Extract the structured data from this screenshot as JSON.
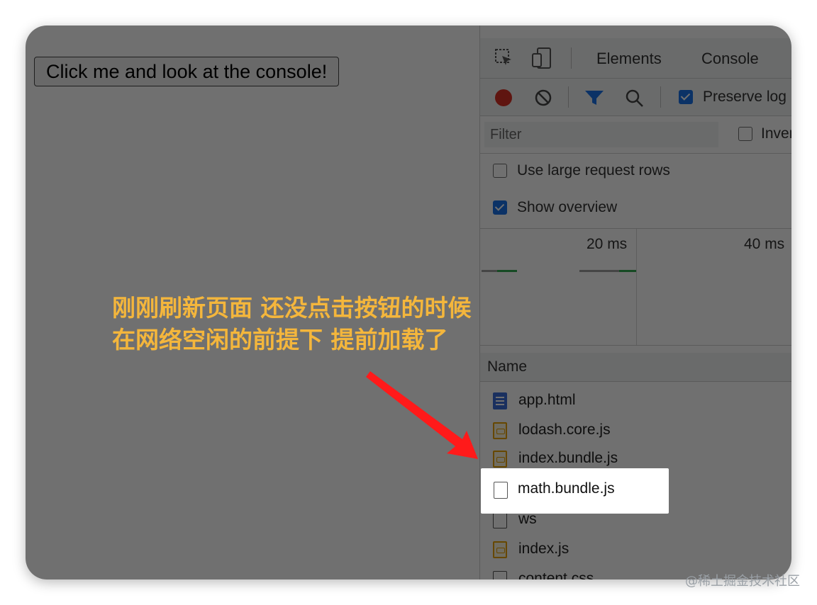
{
  "page": {
    "button_label": "Click me and look at the console!"
  },
  "devtools": {
    "tabs": [
      "Elements",
      "Console"
    ],
    "toolbar": {
      "preserve_log_label": "Preserve log",
      "preserve_log_checked": true
    },
    "filter": {
      "placeholder": "Filter",
      "invert_label": "Invert",
      "invert_checked": false
    },
    "options": {
      "large_rows_label": "Use large request rows",
      "large_rows_checked": false,
      "show_overview_label": "Show overview",
      "show_overview_checked": true
    },
    "overview": {
      "ticks": [
        "20 ms",
        "40 ms"
      ]
    },
    "table": {
      "header": "Name",
      "rows": [
        {
          "name": "app.html",
          "icon": "document-icon"
        },
        {
          "name": "lodash.core.js",
          "icon": "script-icon"
        },
        {
          "name": "index.bundle.js",
          "icon": "script-icon"
        },
        {
          "name": "math.bundle.js",
          "icon": "blank-file-icon",
          "highlighted": true
        },
        {
          "name": "ws",
          "icon": "blank-file-icon"
        },
        {
          "name": "index.js",
          "icon": "script-icon"
        },
        {
          "name": "content.css",
          "icon": "blank-file-icon"
        }
      ]
    }
  },
  "annotation": {
    "line1": "刚刚刷新页面 还没点击按钮的时候",
    "line2": "在网络空闲的前提下 提前加载了",
    "color": "#f4b63c",
    "arrow_color": "#ff1a1a"
  },
  "watermark": "@稀土掘金技术社区",
  "colors": {
    "accent": "#1a73e8",
    "record": "#d93025"
  }
}
